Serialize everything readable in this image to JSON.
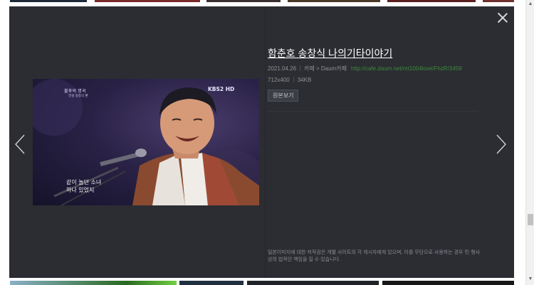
{
  "background": {
    "top_thumb_colors": [
      "#1e2a3a",
      "#7a2a2a",
      "#3a3030",
      "#4a3a2a",
      "#5a2020",
      "#703030"
    ],
    "bottom_thumb_colors": [
      "#8ab0c8",
      "#2a6a20",
      "#203040",
      "#202428",
      "#181818"
    ]
  },
  "viewer": {
    "close_icon": "close-icon",
    "prev_icon": "chevron-left-icon",
    "next_icon": "chevron-right-icon",
    "panel_color": "#2b2d32"
  },
  "image": {
    "broadcast_title": "불후의 명곡",
    "broadcast_subtitle": "전설 송창식 편",
    "channel_logo": "KBS2 HD",
    "caption_line1": "같이 놀던 소녀",
    "caption_line2": "하나 있었지"
  },
  "info": {
    "title": "함춘호 송창식 나의기타이야기",
    "date": "2021.04.26",
    "source_category": "카페 > Daum카페",
    "source_url": "http://cafe.daum.net/mt1004love/FhzR/3459",
    "dimensions": "712x400",
    "file_size": "34KB",
    "original_button": "원본보기",
    "copyright_notice": "일본이미지에 대한 저작권은 개별 사이트의 각 게시자에게 있으며, 이를 무단으로 사용하는 경우 민·형사상의 법적인 책임을 질 수 있습니다."
  }
}
